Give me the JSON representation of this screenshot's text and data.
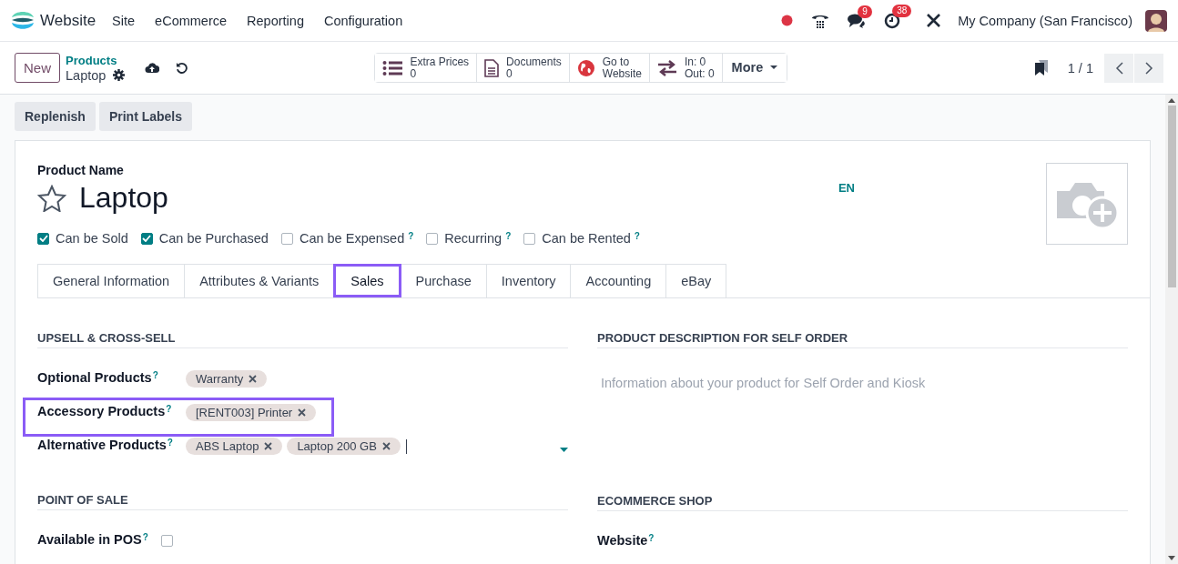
{
  "navbar": {
    "app": "Website",
    "menus": [
      "Site",
      "eCommerce",
      "Reporting",
      "Configuration"
    ],
    "messages_badge": "9",
    "activities_badge": "38",
    "company": "My Company (San Francisco)"
  },
  "control_panel": {
    "new_button": "New",
    "breadcrumb": "Products",
    "record": "Laptop",
    "smart_buttons": [
      {
        "kind": "list",
        "lines": [
          "Extra Prices",
          "0"
        ]
      },
      {
        "kind": "document",
        "lines": [
          "Documents",
          "0"
        ]
      },
      {
        "kind": "globe",
        "lines": [
          "Go to",
          "Website"
        ]
      },
      {
        "kind": "transfer",
        "lines": [
          "In: 0",
          "Out: 0"
        ]
      },
      {
        "kind": "more",
        "lines": [
          "More"
        ]
      }
    ],
    "pager": "1 / 1"
  },
  "actions": [
    "Replenish",
    "Print Labels"
  ],
  "form": {
    "name_label": "Product Name",
    "name": "Laptop",
    "favorite": false,
    "lang": "EN",
    "checkboxes": [
      {
        "label": "Can be Sold",
        "checked": true
      },
      {
        "label": "Can be Purchased",
        "checked": true
      },
      {
        "label": "Can be Expensed",
        "checked": false,
        "help": "?"
      },
      {
        "label": "Recurring",
        "checked": false,
        "help": "?"
      },
      {
        "label": "Can be Rented",
        "checked": false,
        "help": "?"
      }
    ],
    "tabs": [
      {
        "label": "General Information",
        "selected": false
      },
      {
        "label": "Attributes & Variants",
        "selected": false
      },
      {
        "label": "Sales",
        "selected": true
      },
      {
        "label": "Purchase",
        "selected": false
      },
      {
        "label": "Inventory",
        "selected": false
      },
      {
        "label": "Accounting",
        "selected": false
      },
      {
        "label": "eBay",
        "selected": false
      }
    ],
    "upsell": {
      "title": "UPSELL & CROSS-SELL",
      "fields": [
        {
          "label": "Optional Products",
          "help": "?",
          "highlighted": false,
          "tags": [
            "Warranty"
          ]
        },
        {
          "label": "Accessory Products",
          "help": "?",
          "highlighted": true,
          "tags": [
            "[RENT003] Printer"
          ]
        },
        {
          "label": "Alternative Products",
          "help": "?",
          "highlighted": false,
          "tags": [
            "ABS Laptop",
            "Laptop 200 GB"
          ],
          "focused": true
        }
      ]
    },
    "self_order": {
      "title": "PRODUCT DESCRIPTION FOR SELF ORDER",
      "placeholder": "Information about your product for Self Order and Kiosk"
    },
    "pos": {
      "title": "POINT OF SALE",
      "fields": [
        {
          "label": "Available in POS",
          "help": "?",
          "checked": false
        }
      ]
    },
    "ecommerce": {
      "title": "ECOMMERCE SHOP",
      "fields": [
        {
          "label": "Website",
          "help": "?"
        }
      ]
    }
  }
}
